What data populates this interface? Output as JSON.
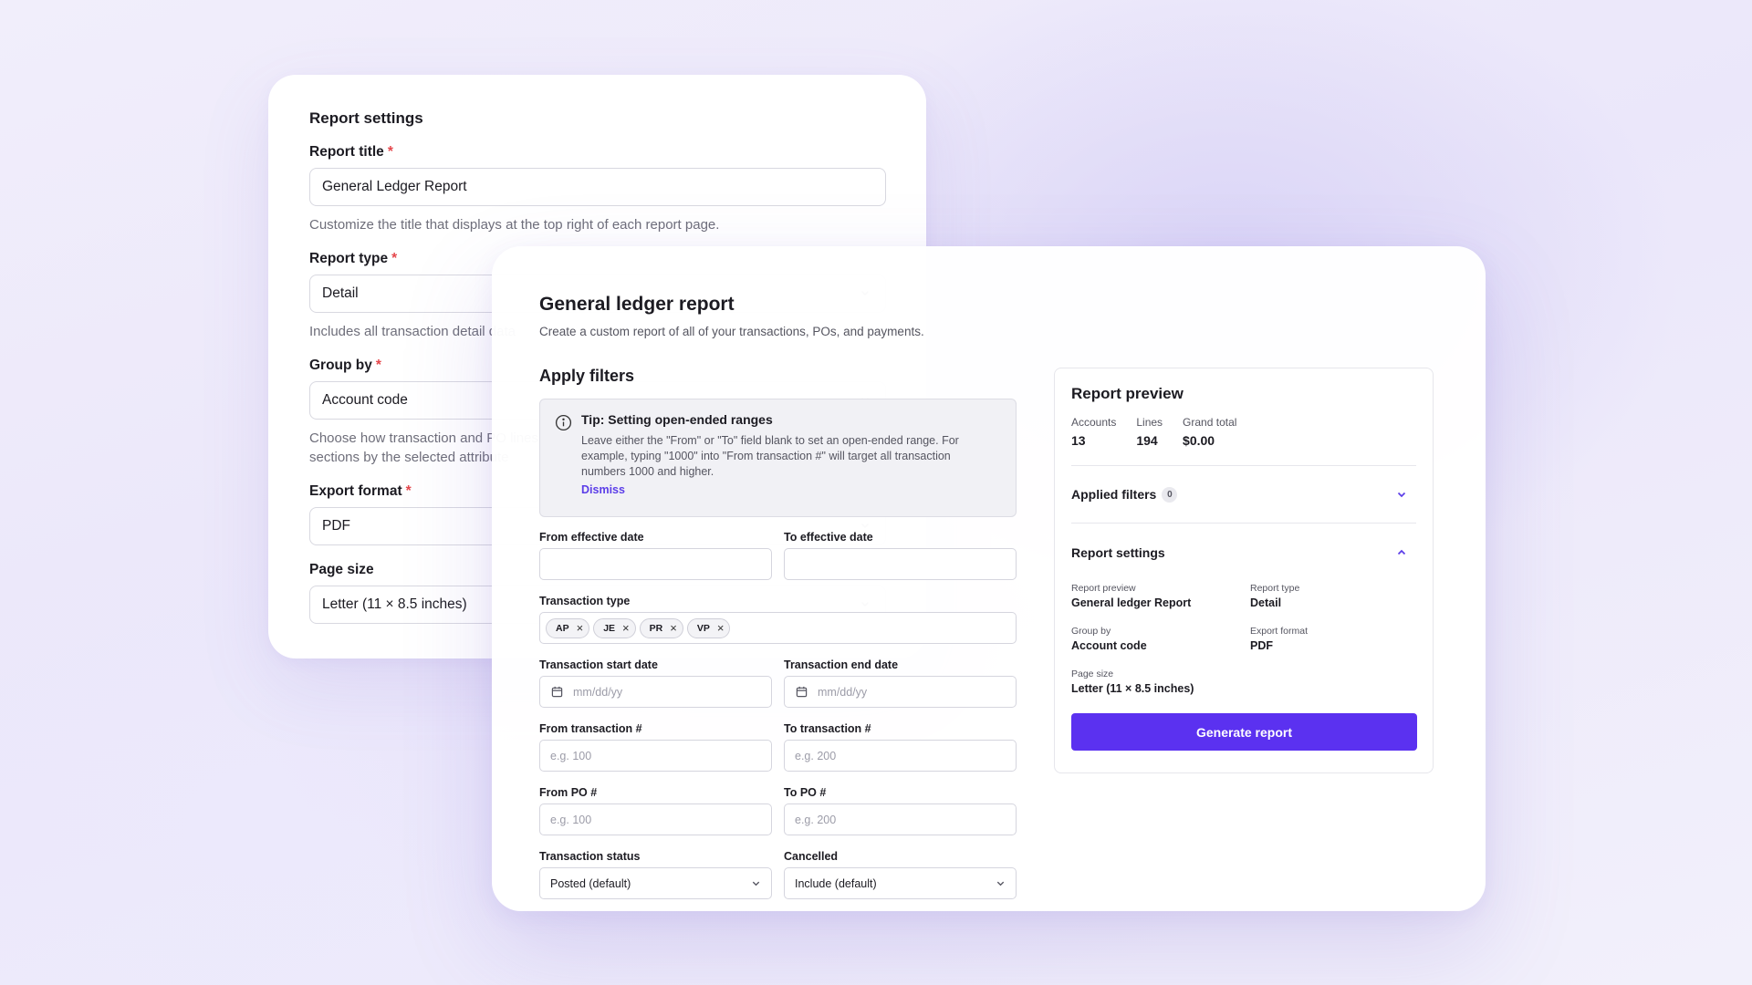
{
  "report_settings": {
    "section_title": "Report settings",
    "required_mark": "*",
    "title_label": "Report title",
    "title_value": "General Ledger Report",
    "title_help": "Customize the title that displays at the top right of each report page.",
    "type_label": "Report type",
    "type_value": "Detail",
    "type_help": "Includes all transaction detail data",
    "group_label": "Group by",
    "group_value": "Account code",
    "group_help_line1": "Choose how transaction and PO lines",
    "group_help_line2": "sections by the selected attribute",
    "export_label": "Export format",
    "export_value": "PDF",
    "page_label": "Page size",
    "page_value": "Letter (11 × 8.5 inches)"
  },
  "gl_report": {
    "title": "General ledger report",
    "subtitle": "Create a custom report of all of your transactions, POs, and payments.",
    "filters_title": "Apply filters",
    "tip": {
      "title": "Tip: Setting open-ended ranges",
      "body": "Leave either the \"From\" or \"To\" field blank to set an open-ended range. For example, typing \"1000\" into \"From transaction #\" will target all transaction numbers 1000 and higher.",
      "dismiss": "Dismiss"
    },
    "fields": {
      "from_effective_date": "From effective date",
      "to_effective_date": "To effective date",
      "transaction_type": "Transaction type",
      "transaction_start_date": "Transaction start date",
      "transaction_end_date": "Transaction end date",
      "date_placeholder": "mm/dd/yy",
      "from_transaction": "From transaction #",
      "to_transaction": "To transaction #",
      "from_po": "From PO #",
      "to_po": "To PO #",
      "placeholder_from": "e.g. 100",
      "placeholder_to": "e.g. 200",
      "transaction_status": "Transaction status",
      "transaction_status_value": "Posted (default)",
      "cancelled": "Cancelled",
      "cancelled_value": "Include (default)"
    },
    "chips": [
      "AP",
      "JE",
      "PR",
      "VP"
    ],
    "chip_remove": "×"
  },
  "preview": {
    "title": "Report preview",
    "stats": [
      {
        "label": "Accounts",
        "value": "13"
      },
      {
        "label": "Lines",
        "value": "194"
      },
      {
        "label": "Grand total",
        "value": "$0.00"
      }
    ],
    "applied_filters_label": "Applied filters",
    "applied_filters_count": "0",
    "settings_label": "Report settings",
    "settings": [
      {
        "label": "Report preview",
        "value": "General ledger Report"
      },
      {
        "label": "Report type",
        "value": "Detail"
      },
      {
        "label": "Group by",
        "value": "Account code"
      },
      {
        "label": "Export format",
        "value": "PDF"
      },
      {
        "label": "Page size",
        "value": "Letter (11 × 8.5 inches)"
      }
    ],
    "generate_label": "Generate report"
  },
  "colors": {
    "accent": "#5b31f0",
    "link": "#5b3de8",
    "required": "#e5484d"
  },
  "icons": [
    "chevron-down-icon",
    "chevron-up-icon",
    "info-icon",
    "calendar-icon",
    "close-icon"
  ]
}
